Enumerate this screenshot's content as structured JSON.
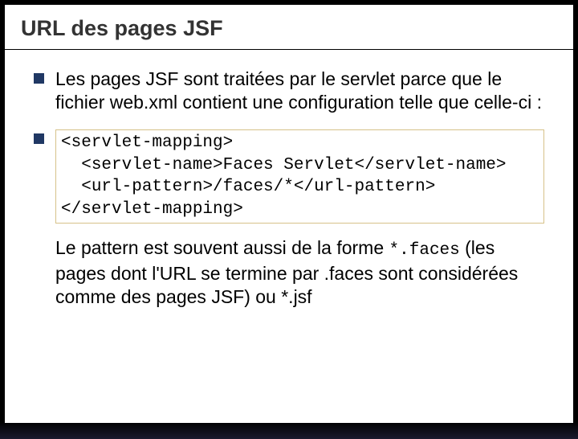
{
  "title": "URL des pages JSF",
  "bullet1": "Les pages JSF sont traitées par le servlet parce que le fichier web.xml contient une configuration telle que celle-ci :",
  "code": {
    "line1": "<servlet-mapping>",
    "line2": "  <servlet-name>Faces Servlet</servlet-name>",
    "line3": "  <url-pattern>/faces/*</url-pattern>",
    "line4": "</servlet-mapping>"
  },
  "followup_pre": "Le pattern est souvent aussi de la forme ",
  "followup_code1": "*.faces",
  "followup_mid": " (les pages dont l'URL se termine par .faces sont considérées comme des pages JSF) ou *.jsf"
}
